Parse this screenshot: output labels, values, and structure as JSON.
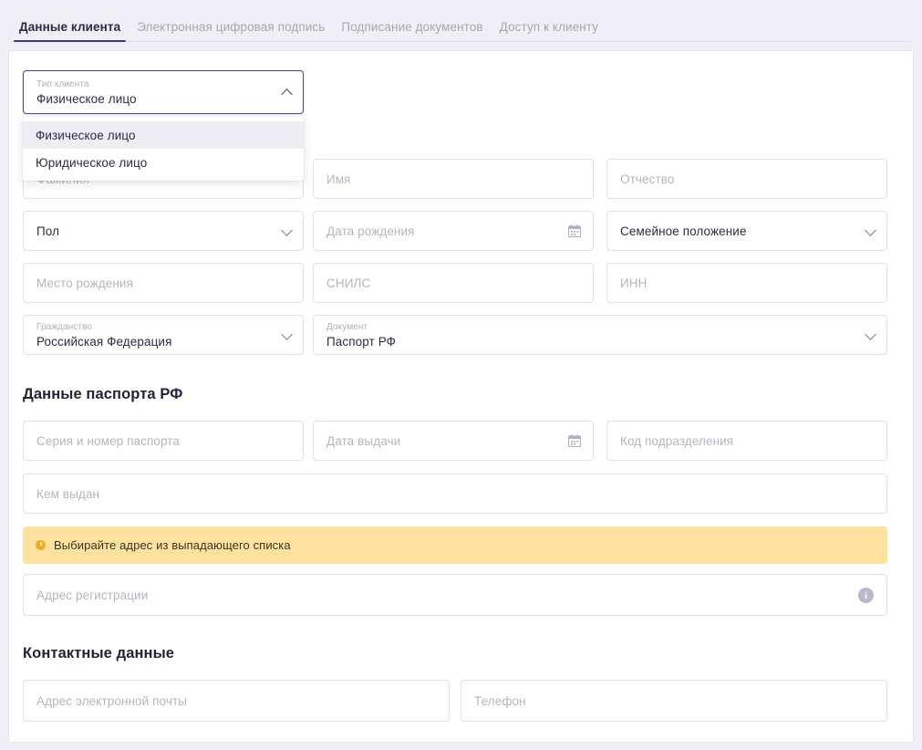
{
  "tabs": [
    {
      "label": "Данные клиента",
      "active": true
    },
    {
      "label": "Электронная цифровая подпись",
      "active": false
    },
    {
      "label": "Подписание документов",
      "active": false
    },
    {
      "label": "Доступ к клиенту",
      "active": false
    }
  ],
  "client_type": {
    "label": "Тип клиента",
    "value": "Физическое лицо",
    "expanded": true,
    "options": [
      {
        "label": "Физическое лицо",
        "selected": true
      },
      {
        "label": "Юридическое лицо",
        "selected": false
      }
    ]
  },
  "personal": {
    "surname_placeholder": "Фамилия",
    "name_placeholder": "Имя",
    "patronymic_placeholder": "Отчество",
    "gender_placeholder": "Пол",
    "birthdate_placeholder": "Дата рождения",
    "marital_placeholder": "Семейное положение",
    "birthplace_placeholder": "Место рождения",
    "snils_placeholder": "СНИЛС",
    "inn_placeholder": "ИНН",
    "citizenship_label": "Гражданство",
    "citizenship_value": "Российская Федерация",
    "document_label": "Документ",
    "document_value": "Паспорт РФ"
  },
  "passport": {
    "heading": "Данные паспорта РФ",
    "series_number_placeholder": "Серия и номер паспорта",
    "issue_date_placeholder": "Дата выдачи",
    "department_code_placeholder": "Код подразделения",
    "issued_by_placeholder": "Кем выдан"
  },
  "address": {
    "warning_text": "Выбирайте адрес из выпадающего списка",
    "registration_placeholder": "Адрес регистрации",
    "info_glyph": "i"
  },
  "contacts": {
    "heading": "Контактные данные",
    "email_placeholder": "Адрес электронной почты",
    "phone_placeholder": "Телефон"
  },
  "colors": {
    "page_background": "#f0eff5",
    "card_background": "#ffffff",
    "accent": "#3d3c7a",
    "select_open_border": "#4b4a86",
    "warning_background": "#ffe1a0",
    "warning_icon": "#f0ad21",
    "placeholder_text": "#b6b4c2",
    "value_text": "#2b2b46",
    "menu_selected_background": "#eeedf4"
  }
}
